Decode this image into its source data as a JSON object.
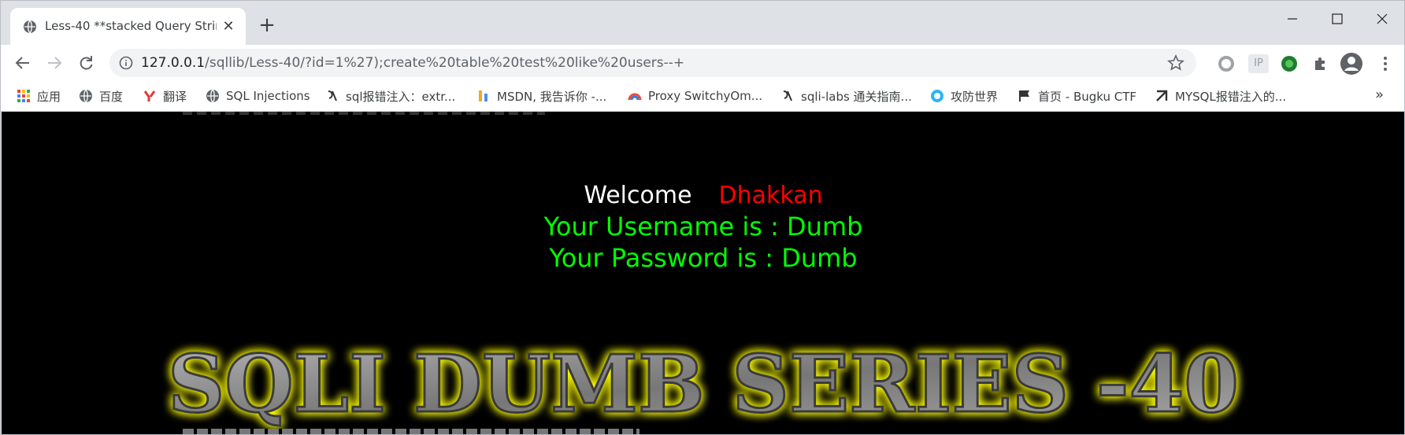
{
  "browser": {
    "tab": {
      "title": "Less-40 **stacked Query String",
      "close_glyph": "✕",
      "favicon": "globe-icon"
    },
    "new_tab_glyph": "+",
    "address": {
      "host": "127.0.0.1",
      "path": "/sqllib/Less-40/?id=1%27);create%20table%20test%20like%20users--+"
    },
    "extensions": [
      "circle-extension-icon",
      "ip-extension-icon",
      "green-extension-icon",
      "puzzle-icon",
      "profile-icon",
      "menu-icon"
    ],
    "ip_ext_label": "IP",
    "bookmarks": [
      {
        "label": "应用",
        "icon": "apps-grid-icon"
      },
      {
        "label": "百度",
        "icon": "globe-icon"
      },
      {
        "label": "翻译",
        "icon": "youdao-icon"
      },
      {
        "label": "SQL Injections",
        "icon": "globe-icon"
      },
      {
        "label": "sql报错注入：extr...",
        "icon": "csdn-icon"
      },
      {
        "label": "MSDN, 我告诉你 -...",
        "icon": "msdn-icon"
      },
      {
        "label": "Proxy SwitchyOm...",
        "icon": "switchy-icon"
      },
      {
        "label": "sqli-labs 通关指南...",
        "icon": "csdn-icon"
      },
      {
        "label": "攻防世界",
        "icon": "adworld-icon"
      },
      {
        "label": "首页 - Bugku CTF",
        "icon": "flag-icon"
      },
      {
        "label": "MYSQL报错注入的...",
        "icon": "zhihu-icon"
      }
    ],
    "bookmarks_more": "»"
  },
  "page": {
    "welcome": "Welcome",
    "name": "Dhakkan",
    "username_line": "Your Username is : Dumb",
    "password_line": "Your Password is : Dumb",
    "banner": "SQLI DUMB SERIES -40"
  },
  "colors": {
    "background": "#000000",
    "welcome": "#ffffff",
    "name": "#ff0000",
    "result_text": "#00ff00",
    "banner_glow": "#ffff00"
  }
}
